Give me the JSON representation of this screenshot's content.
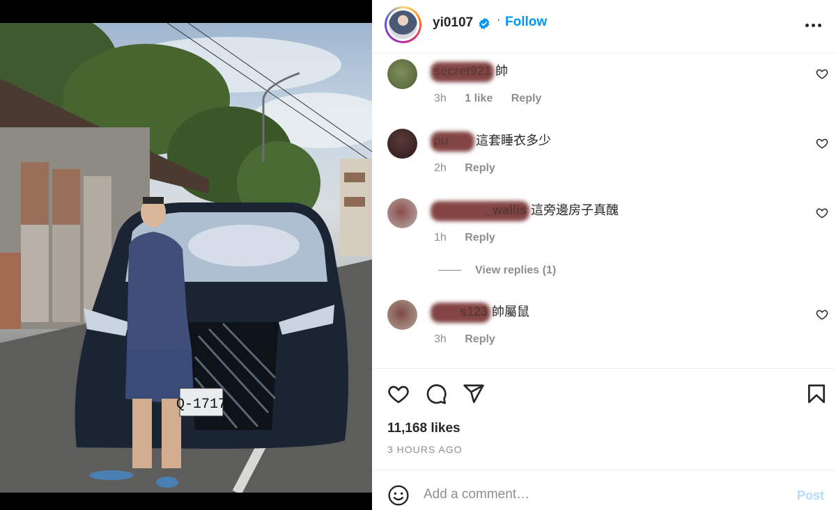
{
  "post": {
    "username": "yi0107",
    "follow_label": "Follow",
    "separator": "·",
    "verified_icon": "verified-badge-icon",
    "more_icon": "more-options-icon"
  },
  "comments": [
    {
      "username": "secret921",
      "text": "帥",
      "time": "3h",
      "likes": "1 like",
      "reply": "Reply"
    },
    {
      "username": "pu",
      "text": "這套睡衣多少",
      "time": "2h",
      "reply": "Reply"
    },
    {
      "username": "_wallis",
      "text": "這旁邊房子真醜",
      "time": "1h",
      "reply": "Reply",
      "view_replies": "View replies (1)"
    },
    {
      "username": "s123",
      "text": "帥屬鼠",
      "time": "3h",
      "reply": "Reply"
    }
  ],
  "actions": {
    "likes": "11,168 likes",
    "time_ago": "3 HOURS AGO",
    "icons": [
      "heart-icon",
      "comment-icon",
      "share-icon",
      "bookmark-icon"
    ]
  },
  "composer": {
    "placeholder": "Add a comment…",
    "post_label": "Post",
    "emoji_icon": "emoji-icon"
  },
  "photo": {
    "plate_text": "Q-1717"
  },
  "colors": {
    "follow": "#0095f6",
    "post_disabled": "#b3dbff",
    "muted": "#8e8e8e",
    "text": "#262626"
  }
}
